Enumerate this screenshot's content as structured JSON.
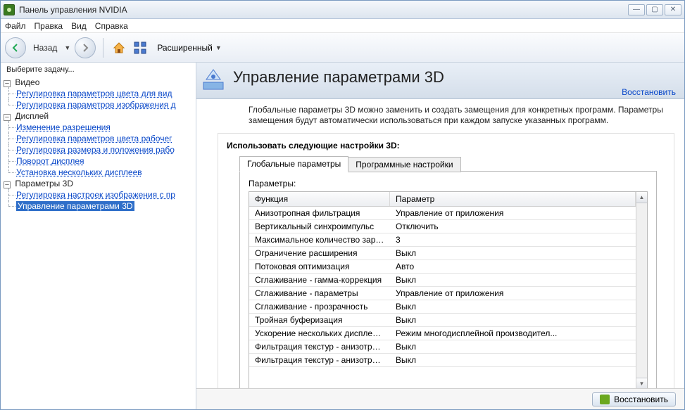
{
  "window": {
    "title": "Панель управления NVIDIA"
  },
  "menu": {
    "file": "Файл",
    "edit": "Правка",
    "view": "Вид",
    "help": "Справка"
  },
  "toolbar": {
    "back_label": "Назад",
    "view_mode": "Расширенный"
  },
  "sidebar": {
    "task_label": "Выберите задачу...",
    "groups": [
      {
        "label": "Видео",
        "items": [
          {
            "label": "Регулировка параметров цвета для вид"
          },
          {
            "label": "Регулировка параметров изображения д"
          }
        ]
      },
      {
        "label": "Дисплей",
        "items": [
          {
            "label": "Изменение разрешения"
          },
          {
            "label": "Регулировка параметров цвета рабочег"
          },
          {
            "label": "Регулировка размера и положения рабо"
          },
          {
            "label": "Поворот дисплея"
          },
          {
            "label": "Установка нескольких дисплеев"
          }
        ]
      },
      {
        "label": "Параметры 3D",
        "items": [
          {
            "label": "Регулировка настроек изображения с пр"
          },
          {
            "label": "Управление параметрами 3D",
            "selected": true
          }
        ]
      }
    ]
  },
  "page": {
    "title": "Управление параметрами 3D",
    "restore_link": "Восстановить",
    "description": "Глобальные параметры 3D можно заменить и создать замещения для конкретных программ. Параметры замещения будут автоматически использоваться при каждом запуске указанных программ.",
    "settings_title": "Использовать следующие настройки 3D:",
    "tabs": {
      "global": "Глобальные параметры",
      "program": "Программные настройки"
    },
    "params_label": "Параметры:",
    "table": {
      "col_function": "Функция",
      "col_param": "Параметр",
      "rows": [
        {
          "f": "Анизотропная фильтрация",
          "p": "Управление от приложения"
        },
        {
          "f": "Вертикальный синхроимпульс",
          "p": "Отключить"
        },
        {
          "f": "Максимальное количество заранее под...",
          "p": "3"
        },
        {
          "f": "Ограничение расширения",
          "p": "Выкл"
        },
        {
          "f": "Потоковая оптимизация",
          "p": "Авто"
        },
        {
          "f": "Сглаживание - гамма-коррекция",
          "p": "Выкл"
        },
        {
          "f": "Сглаживание - параметры",
          "p": "Управление от приложения"
        },
        {
          "f": "Сглаживание - прозрачность",
          "p": "Выкл"
        },
        {
          "f": "Тройная буферизация",
          "p": "Выкл"
        },
        {
          "f": "Ускорение нескольких дисплеев/смеша...",
          "p": "Режим многодисплейной производител..."
        },
        {
          "f": "Фильтрация текстур - анизотропная оп...",
          "p": "Выкл"
        },
        {
          "f": "Фильтрация текстур - анизотропная оп...",
          "p": "Выкл"
        }
      ]
    }
  },
  "footer": {
    "restore_button": "Восстановить"
  }
}
